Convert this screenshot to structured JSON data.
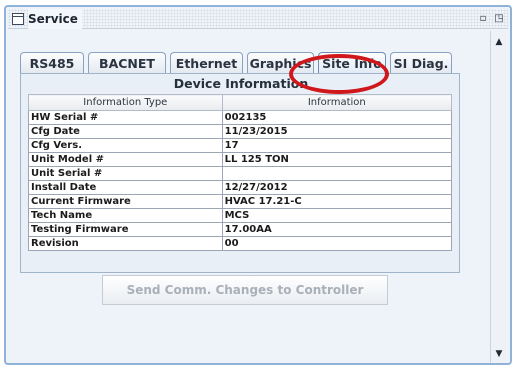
{
  "window": {
    "title": "Service",
    "icon": "window-icon",
    "min_icon": "restore-small-icon",
    "max_icon": "maximize-icon",
    "min_glyph": "▫",
    "max_glyph": "◳"
  },
  "tabs": [
    {
      "label": "RS485",
      "active": false
    },
    {
      "label": "BACNET",
      "active": false
    },
    {
      "label": "Ethernet",
      "active": false
    },
    {
      "label": "Graphics",
      "active": false
    },
    {
      "label": "Site Info",
      "active": true
    },
    {
      "label": "SI Diag.",
      "active": false
    }
  ],
  "device_info": {
    "title": "Device Information",
    "columns": [
      "Information Type",
      "Information"
    ],
    "rows": [
      [
        "HW Serial #",
        "002135"
      ],
      [
        "Cfg Date",
        "11/23/2015"
      ],
      [
        "Cfg Vers.",
        "17"
      ],
      [
        "Unit Model #",
        "LL 125 TON"
      ],
      [
        "Unit Serial #",
        ""
      ],
      [
        "Install Date",
        "12/27/2012"
      ],
      [
        "Current Firmware",
        "HVAC 17.21-C"
      ],
      [
        "Tech Name",
        "MCS"
      ],
      [
        "Testing Firmware",
        "17.00AA"
      ],
      [
        "Revision",
        "00"
      ]
    ]
  },
  "send_button": {
    "label": "Send Comm. Changes to Controller",
    "enabled": false
  },
  "scrollbar": {
    "up": "▲",
    "down": "▼"
  },
  "colors": {
    "annotation": "#d0181c",
    "accent": "#8fb2d8"
  }
}
